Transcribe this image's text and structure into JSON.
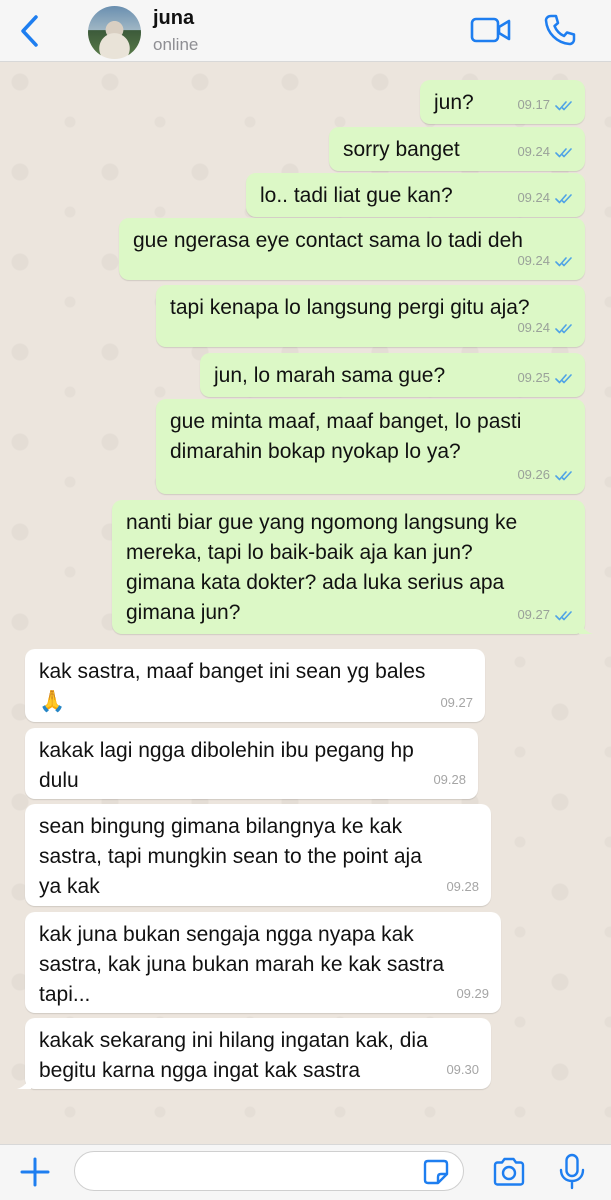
{
  "header": {
    "contact_name": "juna",
    "status": "online",
    "icons": {
      "back": "chevron-left-icon",
      "video": "video-camera-icon",
      "call": "phone-icon"
    }
  },
  "colors": {
    "accent": "#1e7ef0",
    "outgoing_bubble": "#dcf8c6",
    "incoming_bubble": "#ffffff",
    "chat_background": "#ece5dd",
    "read_ticks": "#4fa3e6"
  },
  "messages": [
    {
      "direction": "out",
      "text": "jun?",
      "time": "09.17",
      "read": true
    },
    {
      "direction": "out",
      "text": "sorry banget",
      "time": "09.24",
      "read": true
    },
    {
      "direction": "out",
      "text": "lo.. tadi liat gue kan?",
      "time": "09.24",
      "read": true
    },
    {
      "direction": "out",
      "text": "gue ngerasa eye contact sama lo tadi deh",
      "time": "09.24",
      "read": true
    },
    {
      "direction": "out",
      "text": "tapi kenapa lo langsung pergi gitu aja?",
      "time": "09.24",
      "read": true
    },
    {
      "direction": "out",
      "text": "jun, lo  marah sama gue?",
      "time": "09.25",
      "read": true
    },
    {
      "direction": "out",
      "text": "gue minta maaf, maaf banget, lo pasti\ndimarahin bokap nyokap lo ya?",
      "time": "09.26",
      "read": true
    },
    {
      "direction": "out",
      "text": "nanti biar gue yang ngomong langsung ke\nmereka, tapi lo baik-baik aja kan jun?\ngimana kata dokter? ada luka serius apa\ngimana jun?",
      "time": "09.27",
      "read": true
    },
    {
      "direction": "in",
      "text": "kak sastra, maaf banget ini sean yg bales\n🙏",
      "time": "09.27"
    },
    {
      "direction": "in",
      "text": "kakak lagi ngga dibolehin ibu pegang hp\ndulu",
      "time": "09.28"
    },
    {
      "direction": "in",
      "text": "sean bingung gimana bilangnya ke kak\nsastra, tapi mungkin sean to the point aja\nya kak",
      "time": "09.28"
    },
    {
      "direction": "in",
      "text": "kak juna bukan sengaja ngga nyapa kak\nsastra, kak juna bukan marah ke kak sastra\ntapi...",
      "time": "09.29"
    },
    {
      "direction": "in",
      "text": "kakak sekarang ini hilang ingatan kak, dia\nbegitu karna ngga ingat kak sastra",
      "time": "09.30"
    }
  ],
  "composer": {
    "placeholder": "",
    "icons": {
      "add": "plus-icon",
      "sticker": "sticker-icon",
      "camera": "camera-icon",
      "mic": "microphone-icon"
    }
  }
}
